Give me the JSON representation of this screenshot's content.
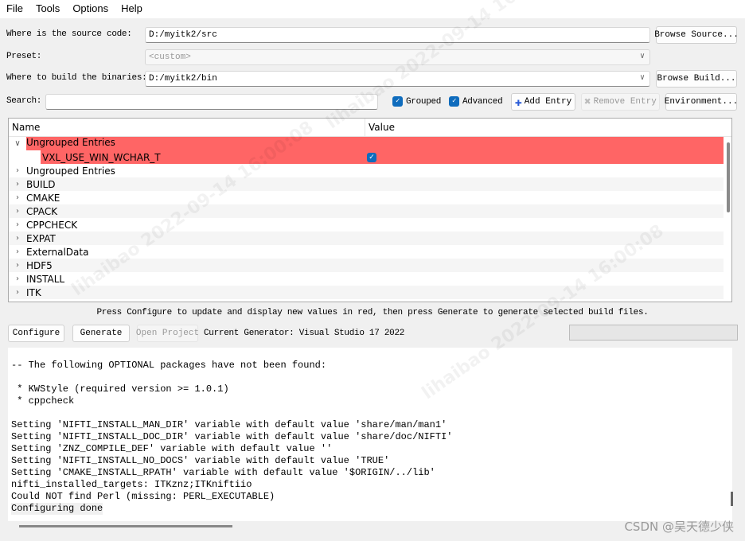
{
  "menu": [
    "File",
    "Tools",
    "Options",
    "Help"
  ],
  "source": {
    "label": "Where is the source code:",
    "value": "D:/myitk2/src",
    "button": "Browse Source..."
  },
  "preset": {
    "label": "Preset:",
    "value": "<custom>"
  },
  "build": {
    "label": "Where to build the binaries:",
    "value": "D:/myitk2/bin",
    "button": "Browse Build..."
  },
  "search": {
    "label": "Search:",
    "value": ""
  },
  "toolbar": {
    "grouped": "Grouped",
    "grouped_checked": true,
    "advanced": "Advanced",
    "advanced_checked": true,
    "add_entry": "Add Entry",
    "remove_entry": "Remove Entry",
    "environment": "Environment..."
  },
  "tree": {
    "col_name": "Name",
    "col_value": "Value",
    "highlight_color": "#ff6565",
    "expanded_group": "Ungrouped Entries",
    "expanded_child": {
      "name": "VXL_USE_WIN_WCHAR_T",
      "checked": true
    },
    "groups": [
      "Ungrouped Entries",
      "BUILD",
      "CMAKE",
      "CPACK",
      "CPPCHECK",
      "EXPAT",
      "ExternalData",
      "HDF5",
      "INSTALL",
      "ITK"
    ]
  },
  "hint": "Press Configure to update and display new values in red, then press Generate to generate selected build files.",
  "actions": {
    "configure": "Configure",
    "generate": "Generate",
    "open_project": "Open Project",
    "generator": "Current Generator: Visual Studio 17 2022"
  },
  "output": [
    "",
    "-- The following OPTIONAL packages have not been found:",
    "",
    " * KWStyle (required version >= 1.0.1)",
    " * cppcheck",
    "",
    "Setting 'NIFTI_INSTALL_MAN_DIR' variable with default value 'share/man/man1'",
    "Setting 'NIFTI_INSTALL_DOC_DIR' variable with default value 'share/doc/NIFTI'",
    "Setting 'ZNZ_COMPILE_DEF' variable with default value ''",
    "Setting 'NIFTI_INSTALL_NO_DOCS' variable with default value 'TRUE'",
    "Setting 'CMAKE_INSTALL_RPATH' variable with default value '$ORIGIN/../lib'",
    "nifti_installed_targets: ITKznz;ITKniftiio",
    "Could NOT find Perl (missing: PERL_EXECUTABLE)",
    "Configuring done"
  ],
  "watermark": "lihaibao 2022-09-14 16:00:08",
  "csdn": "CSDN @吴天德少侠"
}
